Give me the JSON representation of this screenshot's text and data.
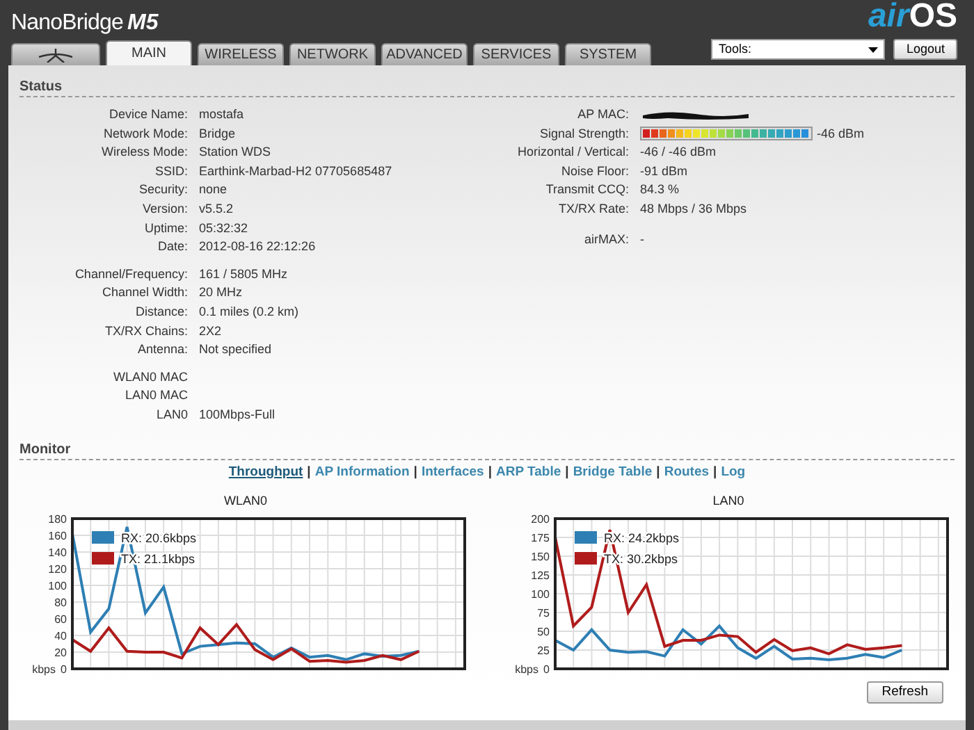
{
  "header": {
    "product": {
      "name": "NanoBridge",
      "model": "M5"
    },
    "os_logo": {
      "prefix": "air",
      "suffix": "OS"
    }
  },
  "tabs": [
    {
      "kind": "icon",
      "selected": false
    },
    {
      "label": "MAIN",
      "selected": true
    },
    {
      "label": "WIRELESS",
      "selected": false
    },
    {
      "label": "NETWORK",
      "selected": false
    },
    {
      "label": "ADVANCED",
      "selected": false
    },
    {
      "label": "SERVICES",
      "selected": false
    },
    {
      "label": "SYSTEM",
      "selected": false
    }
  ],
  "tools": {
    "value": "Tools:"
  },
  "logout_button": "Logout",
  "status": {
    "title": "Status",
    "left_groups": [
      [
        {
          "label": "Device Name:",
          "value": "mostafa"
        },
        {
          "label": "Network Mode:",
          "value": "Bridge"
        },
        {
          "label": "Wireless Mode:",
          "value": "Station WDS"
        },
        {
          "label": "SSID:",
          "value": "Earthink-Marbad-H2 07705685487"
        },
        {
          "label": "Security:",
          "value": "none"
        },
        {
          "label": "Version:",
          "value": "v5.5.2"
        },
        {
          "label": "Uptime:",
          "value": "05:32:32"
        },
        {
          "label": "Date:",
          "value": "2012-08-16 22:12:26"
        }
      ],
      [
        {
          "label": "Channel/Frequency:",
          "value": "161 / 5805 MHz"
        },
        {
          "label": "Channel Width:",
          "value": "20 MHz"
        },
        {
          "label": "Distance:",
          "value": "0.1 miles (0.2 km)"
        },
        {
          "label": "TX/RX Chains:",
          "value": "2X2"
        },
        {
          "label": "Antenna:",
          "value": "Not specified"
        }
      ],
      [
        {
          "label": "WLAN0 MAC"
        },
        {
          "label": "LAN0 MAC"
        },
        {
          "label": "LAN0",
          "value": "100Mbps-Full"
        }
      ]
    ],
    "right_groups": [
      [
        {
          "kind": "redacted",
          "label": "AP MAC:"
        },
        {
          "kind": "meter",
          "label": "Signal Strength:",
          "level": 1,
          "reading": "-46 dBm"
        },
        {
          "label": "Horizontal / Vertical:",
          "value": "-46 / -46 dBm"
        },
        {
          "label": "Noise Floor:",
          "value": "-91 dBm"
        },
        {
          "label": "Transmit CCQ:",
          "value": "84.3 %"
        },
        {
          "label": "TX/RX Rate:",
          "value": "48 Mbps / 36 Mbps"
        }
      ],
      [
        {
          "label": "airMAX:",
          "value": "-"
        }
      ]
    ]
  },
  "monitor": {
    "title": "Monitor",
    "links": [
      {
        "label": "Throughput",
        "selected": true,
        "separator": "|"
      },
      {
        "label": "AP Information",
        "selected": false,
        "separator": "|"
      },
      {
        "label": "Interfaces",
        "selected": false,
        "separator": "|"
      },
      {
        "label": "ARP Table",
        "selected": false,
        "separator": "|"
      },
      {
        "label": "Bridge Table",
        "selected": false,
        "separator": "|"
      },
      {
        "label": "Routes",
        "selected": false,
        "separator": "|"
      },
      {
        "label": "Log",
        "selected": false
      }
    ],
    "charts": [
      {
        "chart_data": {
          "type": "line",
          "title": "WLAN0",
          "grid": true,
          "legend": "upper left",
          "ylabel": "kbps",
          "categories": [
            null,
            null,
            null,
            null,
            null,
            null,
            null,
            null,
            null,
            null,
            null,
            null,
            null,
            null,
            null,
            null,
            null,
            null,
            null,
            null
          ],
          "ylim": [
            0,
            180
          ],
          "yticks": [
            0,
            20,
            40,
            60,
            80,
            100,
            120,
            140,
            160,
            180
          ],
          "series": [
            {
              "name": "RX: 20.6kbps",
              "color": "#2e7fb4",
              "values": [
                162,
                44,
                72,
                170,
                67,
                98,
                18,
                27,
                29,
                31,
                30,
                14,
                25,
                14,
                16,
                11,
                18,
                15,
                16,
                21
              ]
            },
            {
              "name": "TX: 21.1kbps",
              "color": "#b01c1c",
              "values": [
                35,
                21,
                49,
                21,
                20,
                20,
                13,
                49,
                29,
                53,
                23,
                11,
                24,
                9,
                10,
                8,
                10,
                16,
                11,
                21
              ]
            }
          ]
        }
      },
      {
        "chart_data": {
          "type": "line",
          "title": "LAN0",
          "grid": true,
          "legend": "upper left",
          "ylabel": "kbps",
          "categories": [
            null,
            null,
            null,
            null,
            null,
            null,
            null,
            null,
            null,
            null,
            null,
            null,
            null,
            null,
            null,
            null,
            null,
            null,
            null,
            null
          ],
          "ylim": [
            0,
            200
          ],
          "yticks": [
            0,
            25,
            50,
            75,
            100,
            125,
            150,
            175,
            200
          ],
          "series": [
            {
              "name": "RX: 24.2kbps",
              "color": "#2e7fb4",
              "values": [
                38,
                25,
                52,
                25,
                22,
                23,
                17,
                52,
                33,
                57,
                28,
                14,
                30,
                13,
                14,
                12,
                14,
                19,
                15,
                25
              ]
            },
            {
              "name": "TX: 30.2kbps",
              "color": "#b01c1c",
              "values": [
                175,
                57,
                82,
                185,
                75,
                112,
                30,
                38,
                38,
                45,
                43,
                22,
                39,
                24,
                28,
                20,
                32,
                26,
                28,
                31
              ]
            }
          ]
        }
      }
    ],
    "refresh_button": "Refresh"
  }
}
